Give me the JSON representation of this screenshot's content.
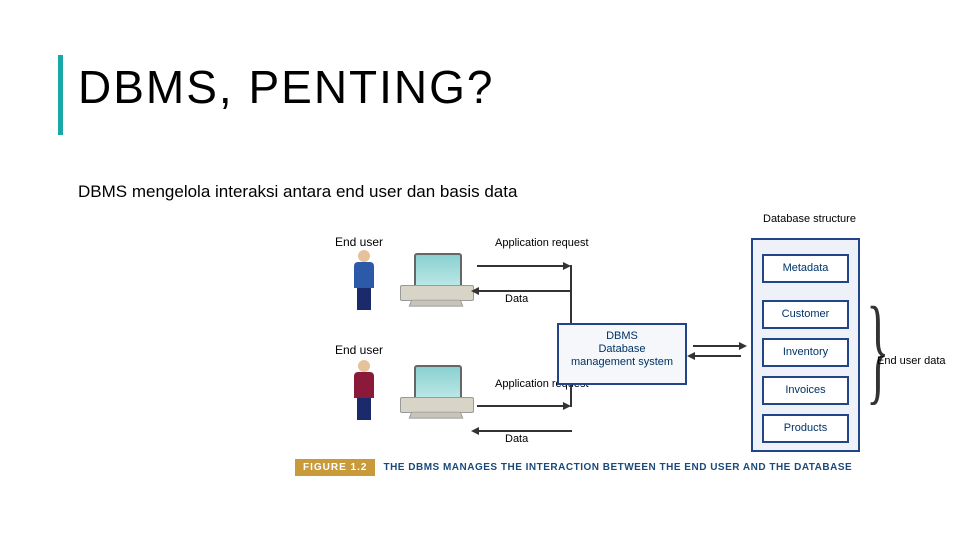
{
  "title": "DBMS, PENTING?",
  "subtitle": "DBMS mengelola interaksi antara end user dan basis data",
  "diagram": {
    "end_user_label_top": "End user",
    "end_user_label_bottom": "End user",
    "arrow_app_request_top": "Application request",
    "arrow_data_top": "Data",
    "arrow_app_request_bottom": "Application request",
    "arrow_data_bottom": "Data",
    "dbms_line1": "DBMS",
    "dbms_line2": "Database",
    "dbms_line3": "management system",
    "db_structure_label": "Database structure",
    "items": {
      "metadata": "Metadata",
      "customer": "Customer",
      "inventory": "Inventory",
      "invoices": "Invoices",
      "products": "Products"
    },
    "end_user_data_label": "End user data"
  },
  "caption": {
    "figure": "FIGURE 1.2",
    "text": "THE DBMS MANAGES THE INTERACTION BETWEEN THE END USER AND THE DATABASE"
  }
}
